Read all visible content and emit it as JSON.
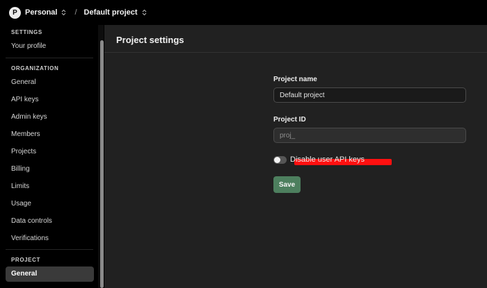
{
  "topbar": {
    "avatar_letter": "P",
    "org_name": "Personal",
    "separator": "/",
    "project_name": "Default project"
  },
  "sidebar": {
    "settings_section": "SETTINGS",
    "your_profile": "Your profile",
    "organization_section": "ORGANIZATION",
    "org_items": [
      "General",
      "API keys",
      "Admin keys",
      "Members",
      "Projects",
      "Billing",
      "Limits",
      "Usage",
      "Data controls",
      "Verifications"
    ],
    "project_section": "PROJECT",
    "project_active_item": "General"
  },
  "main": {
    "title": "Project settings",
    "project_name_label": "Project name",
    "project_name_value": "Default project",
    "project_id_label": "Project ID",
    "project_id_value": "proj_",
    "disable_keys_label": "Disable user API keys",
    "disable_keys_enabled": false,
    "save_label": "Save"
  },
  "colors": {
    "background": "#000000",
    "panel": "#212121",
    "accent_green": "#4d7f5e",
    "redaction": "#ff1010"
  }
}
